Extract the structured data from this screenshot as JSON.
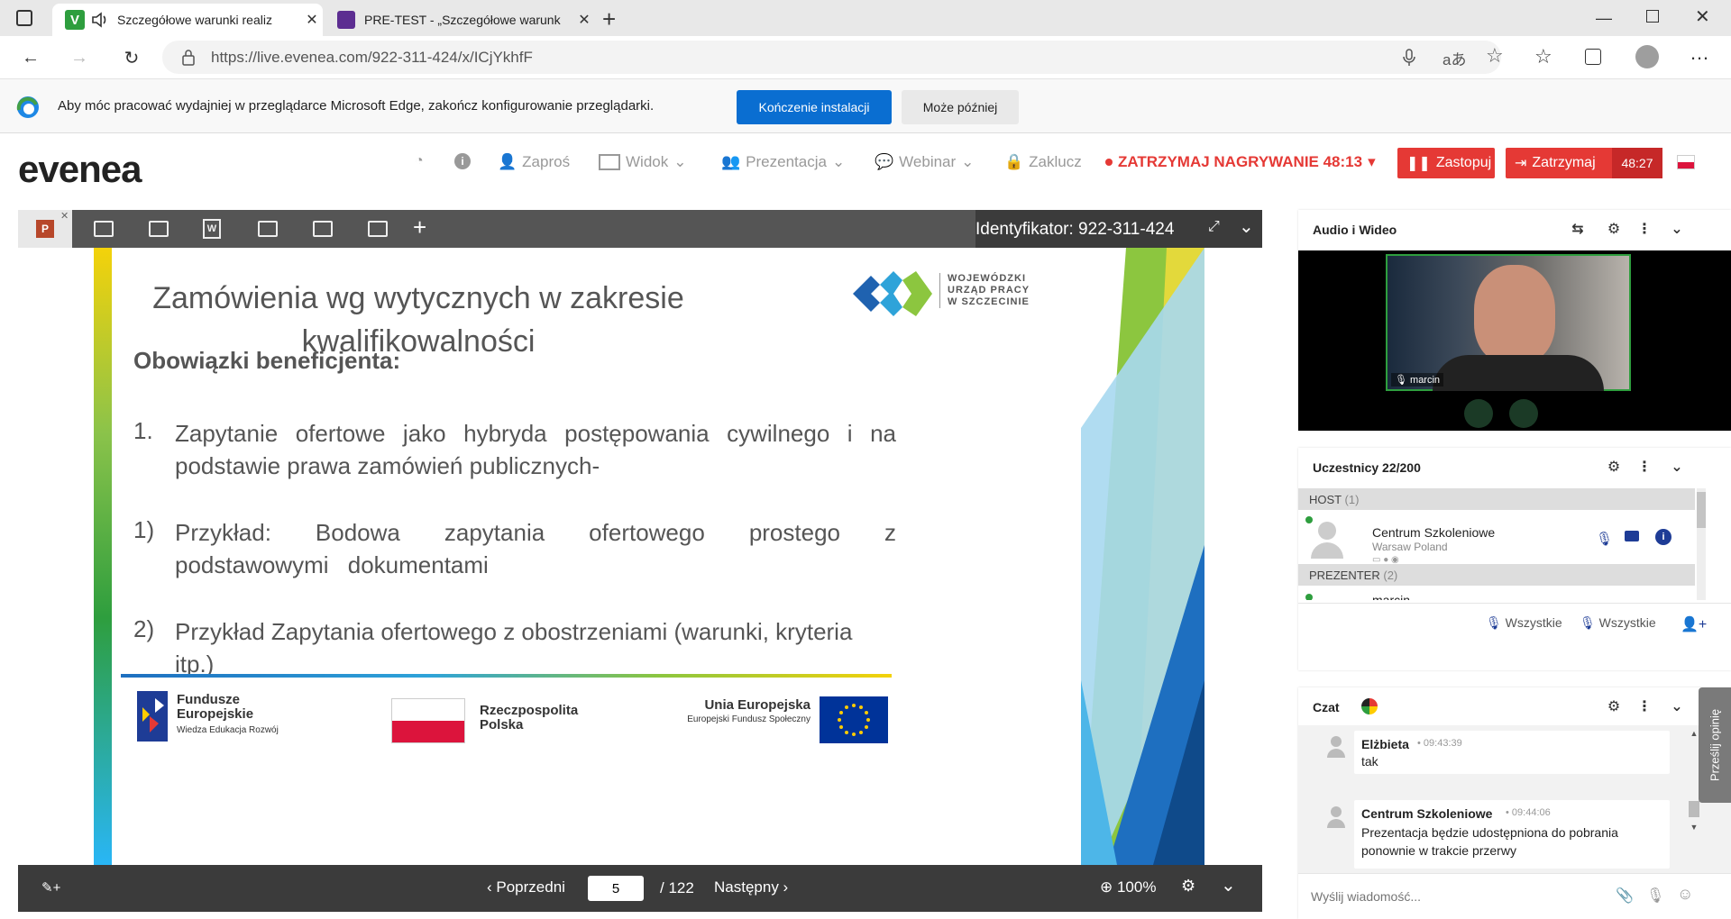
{
  "browser": {
    "tabs": [
      {
        "title": "Szczegółowe warunki realiz",
        "active": true
      },
      {
        "title": "PRE-TEST - „Szczegółowe warunk",
        "active": false
      }
    ],
    "url": "https://live.evenea.com/922-311-424/x/ICjYkhfF",
    "window_controls": [
      "minimize-icon",
      "maximize-icon",
      "close-icon"
    ]
  },
  "infobar": {
    "message": "Aby móc pracować wydajniej w przeglądarce Microsoft Edge, zakończ konfigurowanie przeglądarki.",
    "primary": "Kończenie instalacji",
    "secondary": "Może później"
  },
  "app": {
    "logo": "evenea",
    "menu": {
      "invite": "Zaproś",
      "view": "Widok",
      "presentation": "Prezentacja",
      "webinar": "Webinar",
      "lock": "Zaklucz",
      "recording": "ZATRZYMAJ NAGRYWANIE 48:13"
    },
    "btn_replace": "Zastopuj",
    "btn_stop": "Zatrzymaj",
    "timer": "48:27",
    "colors": {
      "red": "#e53935",
      "accent": "#0a6ed1",
      "logo_green": "#2e9e3e"
    }
  },
  "presentation": {
    "identifier": "Identyfikator: 922-311-424",
    "prev": "Poprzedni",
    "next": "Następny",
    "page": "5",
    "total": "/ 122",
    "zoom": "100%"
  },
  "slide": {
    "title_line1": "Zamówienia wg wytycznych w zakresie",
    "title_line2": "kwalifikowalności",
    "subtitle": "Obowiązki beneficjenta:",
    "item1_num": "1.",
    "item1_text": "Zapytanie ofertowe jako hybryda postępowania cywilnego i na podstawie prawa zamówień publicznych-",
    "item2_num": "1)",
    "item2_text": "Przykład: Bodowa zapytania ofertowego prostego z podstawowymi dokumentami",
    "item3_num": "2)",
    "item3_text": "Przykład Zapytania ofertowego z obostrzeniami (warunki,  kryteria itp.)",
    "logo_office": [
      "WOJEWÓDZKI",
      "URZĄD PRACY",
      "W SZCZECINIE"
    ],
    "footer_fe_1": "Fundusze",
    "footer_fe_2": "Europejskie",
    "footer_fe_3": "Wiedza Edukacja Rozwój",
    "footer_rp_1": "Rzeczpospolita",
    "footer_rp_2": "Polska",
    "footer_ue_1": "Unia Europejska",
    "footer_ue_2": "Europejski Fundusz Społeczny"
  },
  "panels": {
    "av": {
      "title": "Audio i Wideo",
      "speaker": "marcin"
    },
    "participants": {
      "title": "Uczestnicy 22/200",
      "host_header": "HOST",
      "host_count": "(1)",
      "host_name": "Centrum Szkoleniowe",
      "host_location": "Warsaw Poland",
      "presenter_header": "PREZENTER",
      "presenter_count": "(2)",
      "presenter_partial": "marcin",
      "all_label_1": "Wszystkie",
      "all_label_2": "Wszystkie"
    },
    "chat": {
      "title": "Czat",
      "messages": [
        {
          "author": "Elżbieta",
          "time": "09:43:39",
          "text": "tak"
        },
        {
          "author": "Centrum Szkoleniowe",
          "time": "09:44:06",
          "text": "Prezentacja będzie udostępniona do pobrania ponownie w trakcie przerwy"
        }
      ],
      "placeholder": "Wyślij wiadomość..."
    },
    "feedback": "Prześlij opinię"
  }
}
